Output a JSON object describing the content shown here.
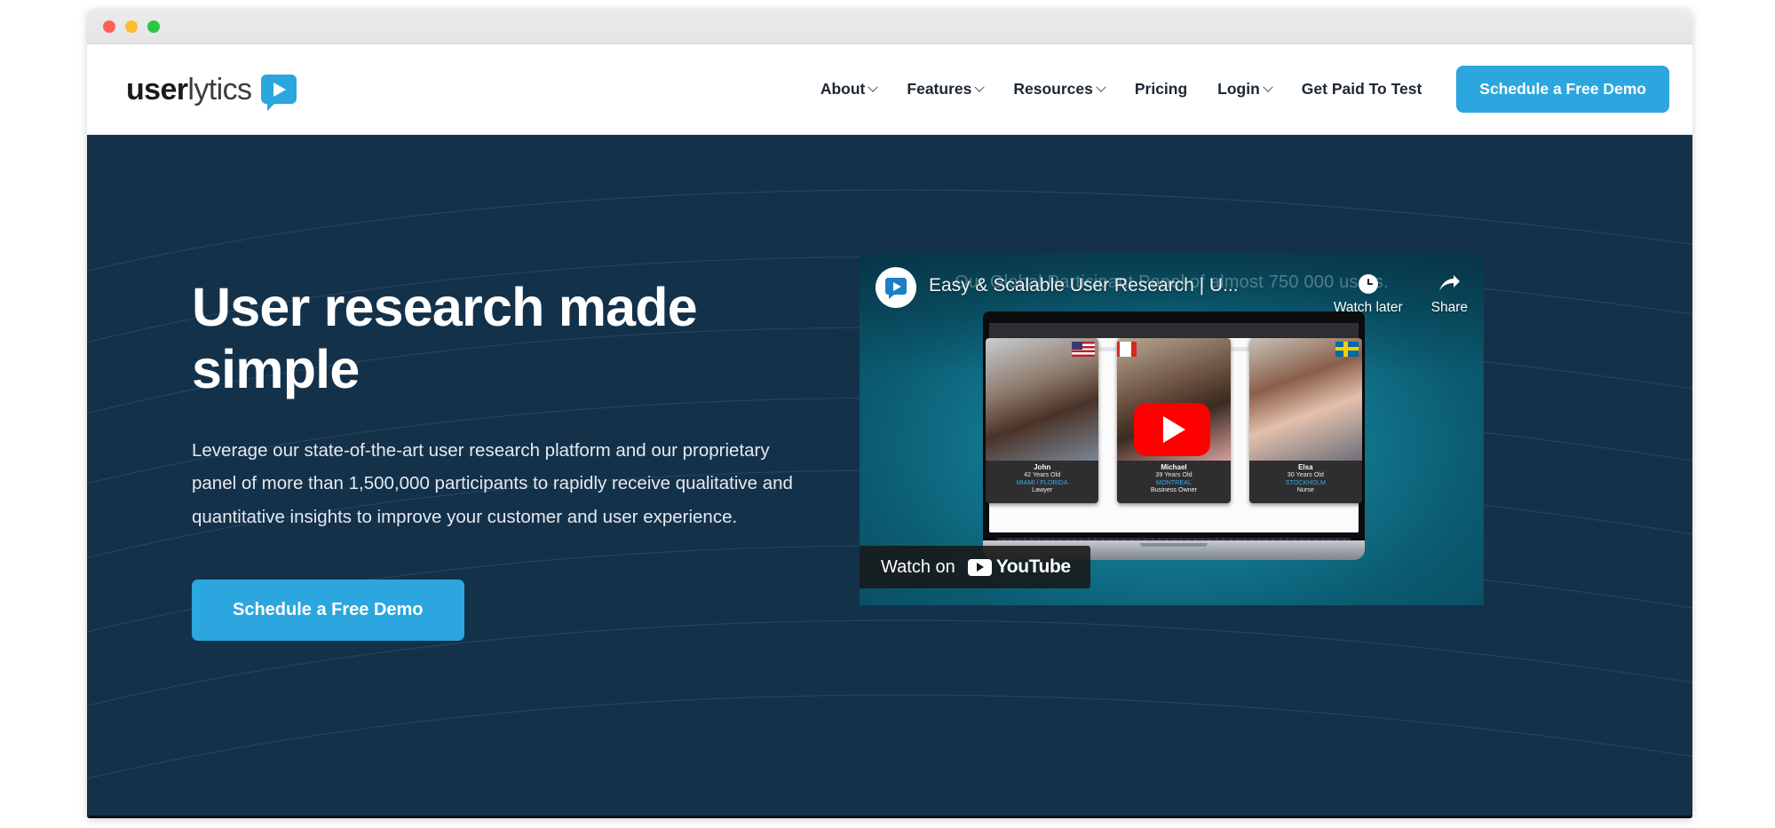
{
  "window": {
    "traffic_lights": [
      {
        "name": "close",
        "color": "#ff6058"
      },
      {
        "name": "minimize",
        "color": "#ffbd2e"
      },
      {
        "name": "maximize",
        "color": "#27c93f"
      }
    ]
  },
  "brand": {
    "logo_bold": "user",
    "logo_light": "lytics",
    "accent_color": "#2ba6de",
    "hero_bg_color": "#14314a"
  },
  "header": {
    "nav": [
      {
        "label": "About",
        "has_dropdown": true
      },
      {
        "label": "Features",
        "has_dropdown": true
      },
      {
        "label": "Resources",
        "has_dropdown": true
      },
      {
        "label": "Pricing",
        "has_dropdown": false
      },
      {
        "label": "Login",
        "has_dropdown": true
      },
      {
        "label": "Get Paid To Test",
        "has_dropdown": false
      }
    ],
    "cta_label": "Schedule a Free Demo"
  },
  "hero": {
    "title": "User research made simple",
    "subtitle": "Leverage our state-of-the-art user research platform and our proprietary panel of more than 1,500,000 participants to rapidly receive qualitative and quantitative insights to improve your customer and user experience.",
    "cta_label": "Schedule a Free Demo"
  },
  "video": {
    "title": "Easy & Scalable User Research | U...",
    "background_caption": "Our Global Participant Panel of almost 750 000 users.",
    "watch_later_label": "Watch later",
    "share_label": "Share",
    "watch_on_label": "Watch on",
    "youtube_label": "YouTube",
    "play_button_color": "#ff0000",
    "participants": [
      {
        "name": "John",
        "age": "42 Years Old",
        "city": "MIAMI / FLORIDA",
        "job": "Lawyer",
        "flag": "flag-us"
      },
      {
        "name": "Michael",
        "age": "39 Years Old",
        "city": "MONTREAL",
        "job": "Business Owner",
        "flag": "flag-ca"
      },
      {
        "name": "Elsa",
        "age": "30 Years Old",
        "city": "STOCKHOLM",
        "job": "Nurse",
        "flag": "flag-se"
      }
    ]
  }
}
